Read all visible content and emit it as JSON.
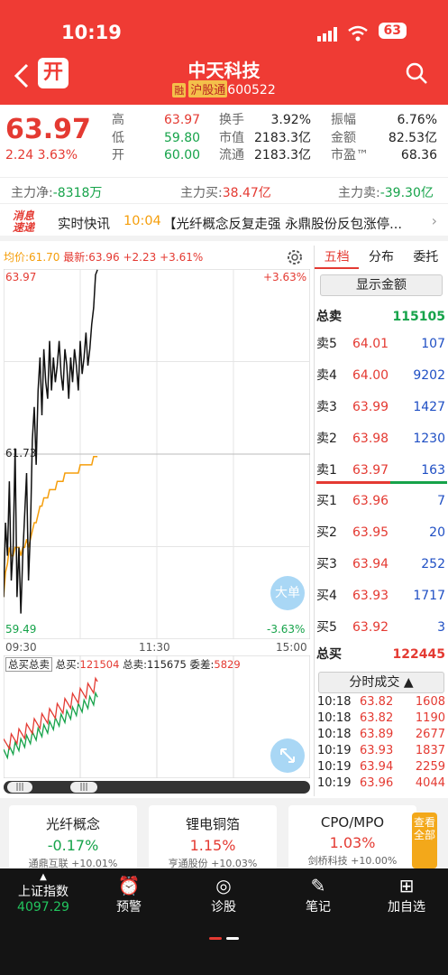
{
  "status": {
    "time": "10:19",
    "battery": "63"
  },
  "header": {
    "back_icon": "chevron-left-icon",
    "open_account_label": "开",
    "title": "中天科技",
    "margin_badge": "融",
    "connect_badge": "沪股通",
    "code": "600522",
    "search_icon": "search-icon"
  },
  "quote": {
    "price": "63.97",
    "change": "2.24",
    "change_pct": "3.63%",
    "high_label": "高",
    "high": "63.97",
    "low_label": "低",
    "low": "59.80",
    "open_label": "开",
    "open": "60.00",
    "turnover_label": "换手",
    "turnover": "3.92%",
    "mktcap_label": "市值",
    "mktcap": "2183.3亿",
    "float_label": "流通",
    "float_cap": "2183.3亿",
    "amplitude_label": "振幅",
    "amplitude": "6.76%",
    "amount_label": "金额",
    "amount": "82.53亿",
    "pe_label": "市盈™",
    "pe": "68.36"
  },
  "flow": {
    "net_label": "主力净:",
    "net": "-8318万",
    "buy_label": "主力买:",
    "buy": "38.47亿",
    "sell_label": "主力卖:",
    "sell": "-39.30亿"
  },
  "news": {
    "logo_line1": "消息",
    "logo_line2": "速递",
    "label": "实时快讯",
    "time": "10:04",
    "text": "【光纤概念反复走强 永鼎股份反包涨停..."
  },
  "chart": {
    "avg_label": "均价:",
    "avg": "61.70",
    "latest_label": "最新:",
    "latest": "63.96",
    "latest_chg": "+2.23",
    "latest_pct": "+3.61%",
    "settings_icon": "gear-icon",
    "top_price": "63.97",
    "top_pct": "+3.63%",
    "mid_price": "61.73",
    "bottom_price": "59.49",
    "bottom_pct": "-3.63%",
    "time_start": "09:30",
    "time_mid": "11:30",
    "time_end": "15:00",
    "big_order_label": "大单",
    "sub_header": "总买总卖",
    "sub_buy_label": "总买:",
    "sub_buy": "121504",
    "sub_sell_label": "总卖:",
    "sub_sell": "115675",
    "sub_diff_label": "委差:",
    "sub_diff": "5829",
    "expand_icon": "expand-icon"
  },
  "chart_data": {
    "type": "line",
    "x": [
      "09:30",
      "09:31",
      "09:32",
      "09:33",
      "09:34",
      "09:35",
      "09:36",
      "09:37",
      "09:38",
      "09:39",
      "09:40",
      "09:41",
      "09:42",
      "09:43",
      "09:44",
      "09:45",
      "09:46",
      "09:47",
      "09:48",
      "09:49",
      "09:50",
      "09:51",
      "09:52",
      "09:53",
      "09:54",
      "09:55",
      "09:56",
      "09:57",
      "09:58",
      "09:59",
      "10:00",
      "10:01",
      "10:02",
      "10:03",
      "10:04",
      "10:05",
      "10:06",
      "10:07",
      "10:08",
      "10:09",
      "10:10",
      "10:11",
      "10:12",
      "10:13",
      "10:14",
      "10:15",
      "10:16",
      "10:17",
      "10:18",
      "10:19"
    ],
    "series": [
      {
        "name": "价格",
        "values": [
          60.0,
          60.9,
          60.5,
          61.4,
          60.2,
          60.6,
          61.8,
          60.0,
          60.6,
          59.8,
          60.5,
          61.0,
          61.5,
          60.2,
          60.8,
          61.9,
          62.3,
          61.6,
          62.5,
          62.9,
          62.2,
          63.0,
          62.6,
          62.4,
          63.1,
          62.5,
          62.9,
          62.6,
          62.8,
          63.1,
          62.7,
          62.5,
          63.0,
          62.8,
          62.4,
          62.9,
          62.6,
          63.0,
          62.8,
          62.5,
          63.1,
          62.7,
          62.9,
          63.2,
          62.8,
          63.0,
          63.3,
          63.5,
          63.9,
          63.96
        ]
      },
      {
        "name": "均价",
        "values": [
          60.0,
          60.3,
          60.4,
          60.6,
          60.5,
          60.5,
          60.6,
          60.6,
          60.6,
          60.5,
          60.6,
          60.6,
          60.7,
          60.6,
          60.7,
          60.8,
          60.9,
          60.9,
          61.0,
          61.1,
          61.1,
          61.2,
          61.2,
          61.2,
          61.3,
          61.3,
          61.3,
          61.3,
          61.4,
          61.4,
          61.4,
          61.4,
          61.5,
          61.5,
          61.5,
          61.5,
          61.5,
          61.5,
          61.5,
          61.5,
          61.6,
          61.6,
          61.6,
          61.6,
          61.6,
          61.6,
          61.6,
          61.7,
          61.7,
          61.7
        ]
      }
    ],
    "ylim": [
      59.49,
      63.97
    ]
  },
  "orderbook": {
    "tabs": [
      "五档",
      "分布",
      "委托"
    ],
    "show_amount": "显示金额",
    "total_sell_label": "总卖",
    "total_sell": "115105",
    "asks": [
      {
        "label": "卖5",
        "price": "64.01",
        "vol": "107"
      },
      {
        "label": "卖4",
        "price": "64.00",
        "vol": "9202"
      },
      {
        "label": "卖3",
        "price": "63.99",
        "vol": "1427"
      },
      {
        "label": "卖2",
        "price": "63.98",
        "vol": "1230"
      },
      {
        "label": "卖1",
        "price": "63.97",
        "vol": "163"
      }
    ],
    "bids": [
      {
        "label": "买1",
        "price": "63.96",
        "vol": "7"
      },
      {
        "label": "买2",
        "price": "63.95",
        "vol": "20"
      },
      {
        "label": "买3",
        "price": "63.94",
        "vol": "252"
      },
      {
        "label": "买4",
        "price": "63.93",
        "vol": "1717"
      },
      {
        "label": "买5",
        "price": "63.92",
        "vol": "3"
      }
    ],
    "total_buy_label": "总买",
    "total_buy": "122445",
    "trades_label": "分时成交",
    "trades": [
      {
        "time": "10:18",
        "price": "63.82",
        "vol": "1608"
      },
      {
        "time": "10:18",
        "price": "63.82",
        "vol": "1190"
      },
      {
        "time": "10:18",
        "price": "63.89",
        "vol": "2677"
      },
      {
        "time": "10:19",
        "price": "63.93",
        "vol": "1837"
      },
      {
        "time": "10:19",
        "price": "63.94",
        "vol": "2259"
      },
      {
        "time": "10:19",
        "price": "63.96",
        "vol": "4044"
      }
    ]
  },
  "sectors": [
    {
      "name": "光纤概念",
      "pct": "-0.17%",
      "sub": "通鼎互联 +10.01%"
    },
    {
      "name": "锂电铜箔",
      "pct": "1.15%",
      "sub": "亨通股份 +10.03%"
    },
    {
      "name": "CPO/MPO",
      "pct": "1.03%",
      "sub": "剑桥科技 +10.00%"
    }
  ],
  "side_tab": "查看全部",
  "nav": {
    "index_name": "上证指数",
    "index_value": "4097.29",
    "items": [
      {
        "label": "预警",
        "icon": "alarm-clock-icon"
      },
      {
        "label": "诊股",
        "icon": "target-icon"
      },
      {
        "label": "笔记",
        "icon": "edit-icon"
      },
      {
        "label": "加自选",
        "icon": "plus-box-icon"
      }
    ]
  },
  "colors": {
    "up": "#e43a32",
    "down": "#16a34a",
    "accent": "#ef3b34",
    "avg_line": "#f59e0b"
  }
}
